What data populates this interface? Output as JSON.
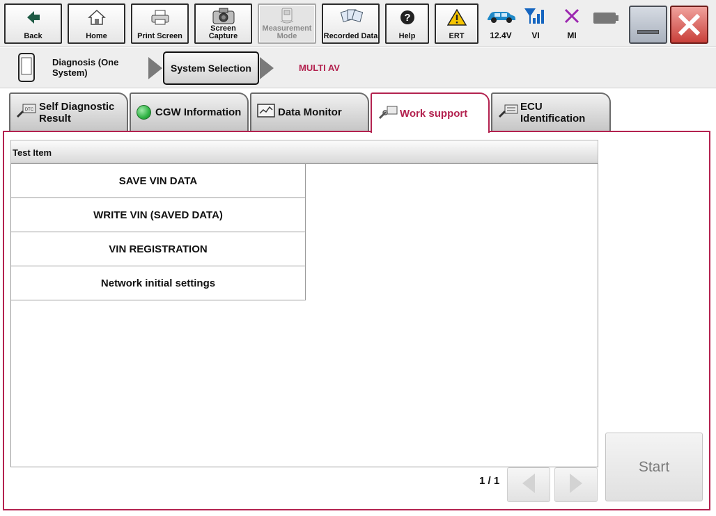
{
  "toolbar": {
    "back": "Back",
    "home": "Home",
    "print_screen": "Print Screen",
    "screen_capture": "Screen Capture",
    "measurement_mode": "Measurement Mode",
    "recorded_data": "Recorded Data",
    "help": "Help",
    "ert": "ERT"
  },
  "status": {
    "battery_voltage": "12.4V",
    "vi": "VI",
    "mi": "MI"
  },
  "breadcrumb": {
    "step1": "Diagnosis (One System)",
    "step2": "System Selection",
    "current_system": "MULTI AV"
  },
  "tabs": [
    {
      "label": "Self Diagnostic Result"
    },
    {
      "label": "CGW Information"
    },
    {
      "label": "Data Monitor"
    },
    {
      "label": "Work support"
    },
    {
      "label": "ECU Identification"
    }
  ],
  "table": {
    "header": "Test Item",
    "rows": [
      {
        "label": "SAVE VIN DATA"
      },
      {
        "label": "WRITE VIN (SAVED DATA)"
      },
      {
        "label": "VIN REGISTRATION"
      },
      {
        "label": "Network initial settings"
      }
    ]
  },
  "pager": {
    "text": "1 / 1"
  },
  "start_label": "Start",
  "colors": {
    "accent": "#b3224f",
    "panel_border": "#b3224f",
    "car_icon": "#1e88c7",
    "signal_icon": "#1565c0",
    "mi_icon": "#9c27b0",
    "warning_icon": "#f5c400",
    "close_button": "#d9534f",
    "cgw_indicator": "#2fb344"
  }
}
